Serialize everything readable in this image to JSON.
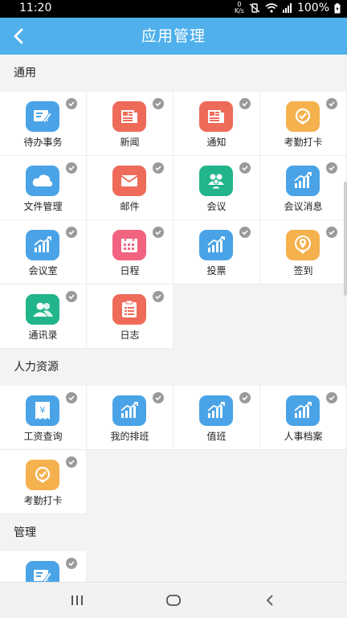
{
  "status": {
    "time": "11:20",
    "battery": "100%",
    "speed_top": "0",
    "speed_unit": "K/s"
  },
  "header": {
    "title": "应用管理"
  },
  "sections": [
    {
      "title": "通用",
      "items": [
        {
          "label": "待办事务",
          "icon": "todo-icon",
          "color": "#4aa3e6"
        },
        {
          "label": "新闻",
          "icon": "news-icon",
          "color": "#ee6b5a"
        },
        {
          "label": "通知",
          "icon": "notice-icon",
          "color": "#ee6b5a"
        },
        {
          "label": "考勤打卡",
          "icon": "attendance-icon",
          "color": "#f5b14e"
        },
        {
          "label": "文件管理",
          "icon": "cloud-icon",
          "color": "#4aa3e6"
        },
        {
          "label": "邮件",
          "icon": "mail-icon",
          "color": "#ee6b5a"
        },
        {
          "label": "会议",
          "icon": "meeting-icon",
          "color": "#22b48a"
        },
        {
          "label": "会议消息",
          "icon": "chart-icon",
          "color": "#4aa3e6"
        },
        {
          "label": "会议室",
          "icon": "chart-icon",
          "color": "#4aa3e6"
        },
        {
          "label": "日程",
          "icon": "calendar-icon",
          "color": "#f2637f"
        },
        {
          "label": "投票",
          "icon": "chart-icon",
          "color": "#4aa3e6"
        },
        {
          "label": "签到",
          "icon": "location-icon",
          "color": "#f5b14e"
        },
        {
          "label": "通讯录",
          "icon": "contacts-icon",
          "color": "#22b48a"
        },
        {
          "label": "日志",
          "icon": "log-icon",
          "color": "#ee6b5a"
        }
      ]
    },
    {
      "title": "人力资源",
      "items": [
        {
          "label": "工资查询",
          "icon": "salary-icon",
          "color": "#4aa3e6"
        },
        {
          "label": "我的排班",
          "icon": "chart-icon",
          "color": "#4aa3e6"
        },
        {
          "label": "值班",
          "icon": "chart-icon",
          "color": "#4aa3e6"
        },
        {
          "label": "人事档案",
          "icon": "chart-icon",
          "color": "#4aa3e6"
        },
        {
          "label": "考勤打卡",
          "icon": "attendance-icon",
          "color": "#f5b14e"
        }
      ]
    },
    {
      "title": "管理",
      "items": [
        {
          "label": "",
          "icon": "todo-icon",
          "color": "#4aa3e6"
        }
      ]
    }
  ]
}
